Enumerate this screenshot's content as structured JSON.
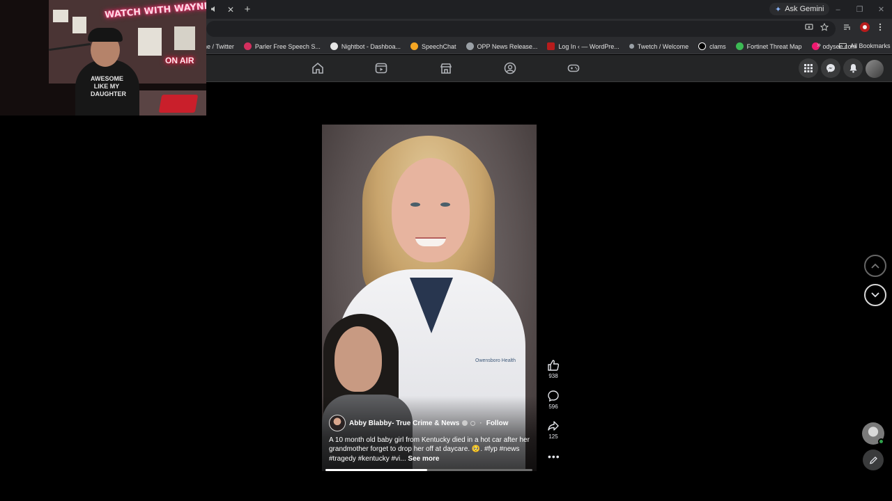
{
  "browser": {
    "ask_gemini_label": "Ask Gemini",
    "tab_audio_icon": "speaker-icon",
    "tab_close_glyph": "✕",
    "new_tab_glyph": "+",
    "window_buttons": [
      "–",
      "❐",
      "✕"
    ]
  },
  "bookmarks": {
    "items": [
      {
        "label": "ne / Twitter",
        "icon": "twitter-icon",
        "color": "#1d9bf0"
      },
      {
        "label": "Parler Free Speech S...",
        "icon": "parler-icon",
        "color": "#d32f5e"
      },
      {
        "label": "Nightbot - Dashboa...",
        "icon": "nightbot-icon",
        "color": "#e6e6e6"
      },
      {
        "label": "SpeechChat",
        "icon": "speechchat-icon",
        "color": "#f5a623"
      },
      {
        "label": "OPP News Release...",
        "icon": "globe-icon",
        "color": "#9aa0a6"
      },
      {
        "label": "Log In ‹ — WordPre...",
        "icon": "wordpress-icon",
        "color": "#b71c1c"
      },
      {
        "label": "Twetch / Welcome",
        "icon": "twetch-icon",
        "color": "#9aa0a6"
      },
      {
        "label": "clams",
        "icon": "amazon-icon",
        "color": "#ffffff"
      },
      {
        "label": "Fortinet Threat Map",
        "icon": "shield-icon",
        "color": "#3cba54"
      },
      {
        "label": "odysee.com",
        "icon": "odysee-icon",
        "color": "#ef1970"
      }
    ],
    "overflow_glyph": "»",
    "all_bookmarks_label": "All Bookmarks"
  },
  "webcam": {
    "neon_top": "WATCH WITH WAYNE",
    "neon_bottom": "ON AIR",
    "shirt_text": "AWESOME LIKE MY DAUGHTER"
  },
  "reel": {
    "author": "Abby Blabby- True Crime & News",
    "follow_label": "Follow",
    "caption": "A 10 month old baby girl from Kentucky died in a hot car after her grandmother forget to drop her off at daycare. 🥺. #fyp #news #tragedy #kentucky #vi...",
    "see_more_label": "See more",
    "coat_logo": "Owensboro Health",
    "progress": 0.49,
    "likes": "938",
    "comments": "596",
    "shares": "125",
    "more_glyph": "•••"
  },
  "colors": {
    "fb_nav_bg": "#242526",
    "chrome_bg": "#2b2c2f",
    "neon_pink": "#ff2a6d",
    "online_green": "#31a24c"
  }
}
